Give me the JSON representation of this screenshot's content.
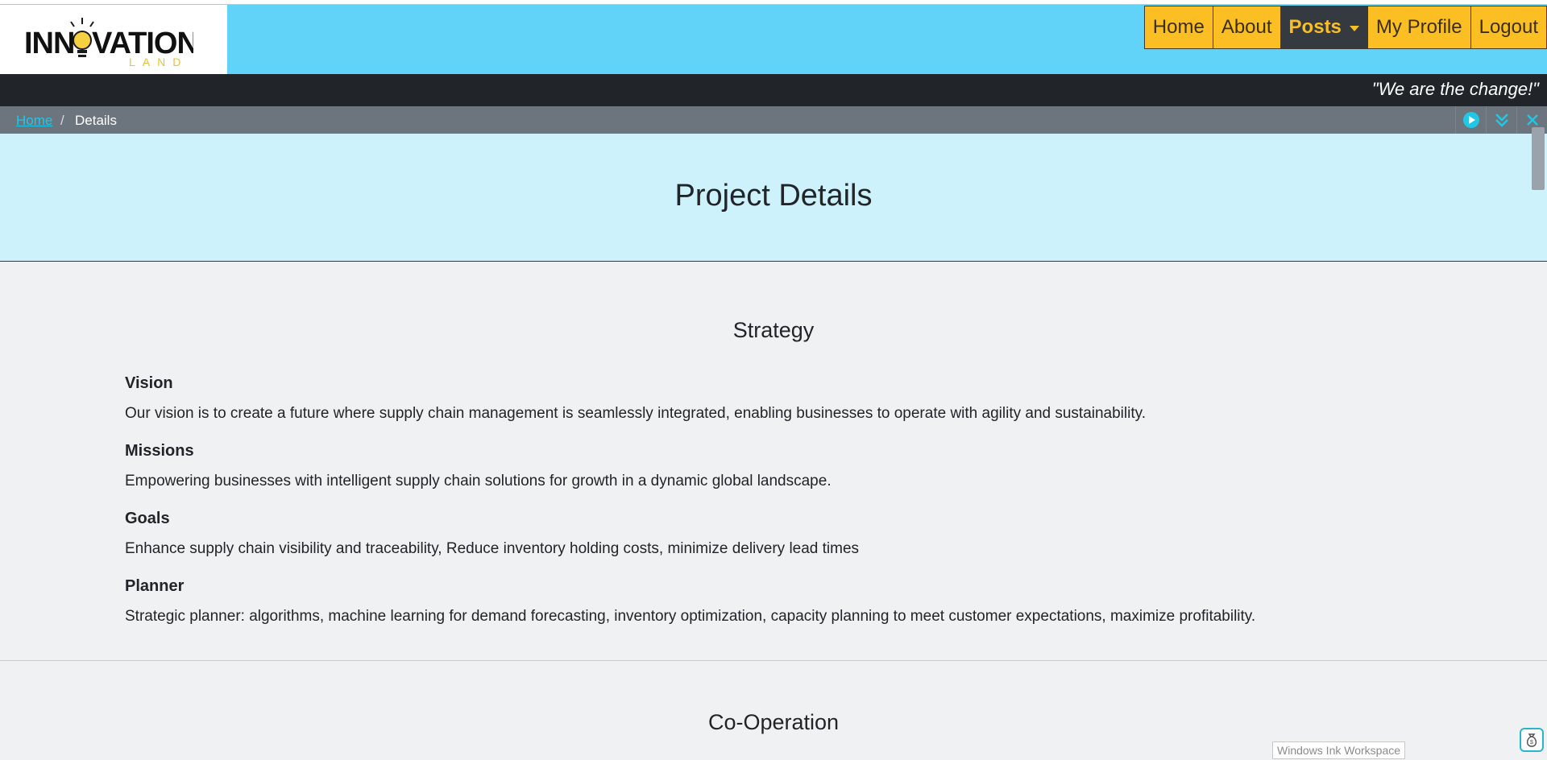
{
  "brand": {
    "logo_text": "INNOVATION",
    "logo_subtext": "LAND"
  },
  "nav": {
    "items": [
      {
        "label": "Home"
      },
      {
        "label": "About"
      },
      {
        "label": "Posts"
      },
      {
        "label": "My Profile"
      },
      {
        "label": "Logout"
      }
    ]
  },
  "slogan": "\"We are the change!\"",
  "breadcrumb": {
    "home": "Home",
    "separator": "/",
    "current": "Details"
  },
  "page": {
    "title": "Project Details"
  },
  "strategy": {
    "title": "Strategy",
    "items": [
      {
        "heading": "Vision",
        "text": "Our vision is to create a future where supply chain management is seamlessly integrated, enabling businesses to operate with agility and sustainability."
      },
      {
        "heading": "Missions",
        "text": "Empowering businesses with intelligent supply chain solutions for growth in a dynamic global landscape."
      },
      {
        "heading": "Goals",
        "text": "Enhance supply chain visibility and traceability, Reduce inventory holding costs, minimize delivery lead times"
      },
      {
        "heading": "Planner",
        "text": "Strategic planner: algorithms, machine learning for demand forecasting, inventory optimization, capacity planning to meet customer expectations, maximize profitability."
      }
    ]
  },
  "cooperation": {
    "title": "Co-Operation"
  },
  "overlay": {
    "ink_label": "Windows Ink Workspace"
  },
  "colors": {
    "header_bg": "#62d3f8",
    "nav_bg": "#fbbf24",
    "nav_active_bg": "#343a40",
    "slogan_bg": "#212529",
    "breadcrumb_bg": "#6c757d",
    "title_banner_bg": "#cdf2fb",
    "page_bg": "#f0f1f3",
    "accent": "#20c7e6"
  },
  "icons": {
    "play": "play-circle-icon",
    "collapse": "double-chevron-down-icon",
    "close": "close-icon",
    "corner": "money-bag-icon",
    "logo_bulb": "lightbulb-icon"
  }
}
